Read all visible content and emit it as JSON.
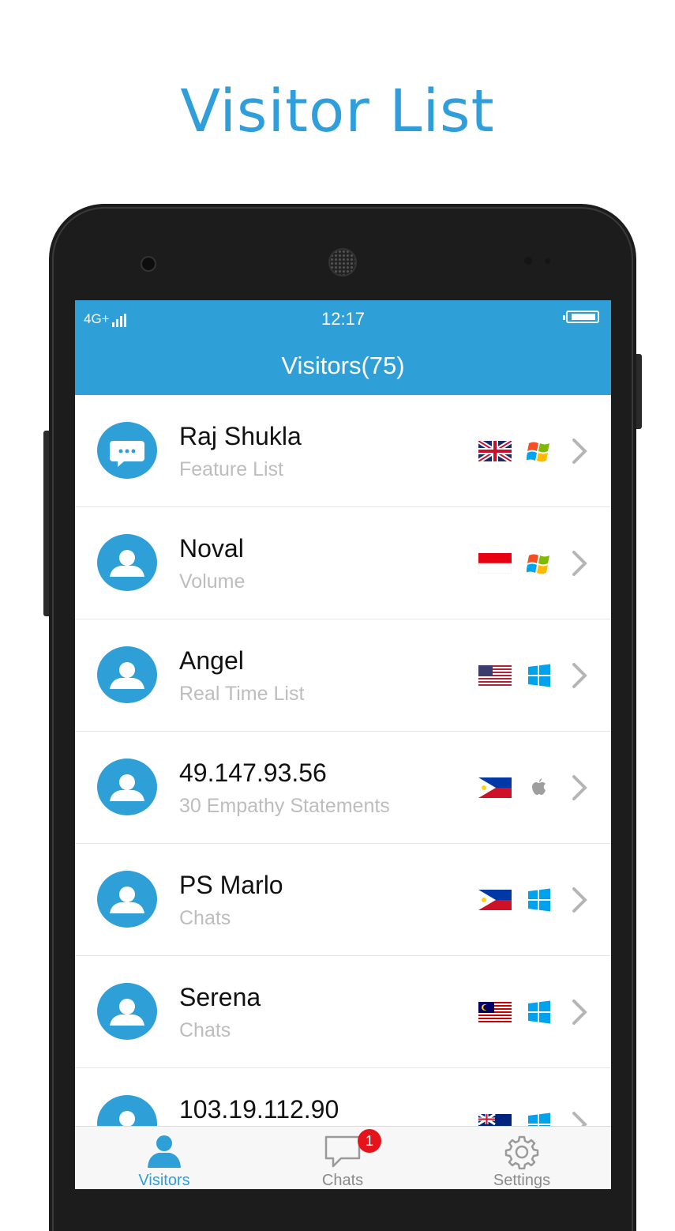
{
  "promo": {
    "title": "Visitor List"
  },
  "status_bar": {
    "network": "4G+",
    "time": "12:17"
  },
  "header": {
    "title": "Visitors(75)"
  },
  "visitors": [
    {
      "name": "Raj Shukla",
      "subtitle": "Feature List",
      "flag": "uk-flag",
      "os": "windows-xp-icon",
      "avatar": "chat-bubble-icon"
    },
    {
      "name": "Noval",
      "subtitle": "Volume",
      "flag": "indonesia-flag",
      "os": "windows-xp-icon",
      "avatar": "user-icon"
    },
    {
      "name": "Angel",
      "subtitle": "Real Time List",
      "flag": "usa-flag",
      "os": "windows-icon",
      "avatar": "user-icon"
    },
    {
      "name": "49.147.93.56",
      "subtitle": "30 Empathy Statements",
      "flag": "philippines-flag",
      "os": "apple-icon",
      "avatar": "user-icon"
    },
    {
      "name": "PS Marlo",
      "subtitle": "Chats",
      "flag": "philippines-flag",
      "os": "windows-icon",
      "avatar": "user-icon"
    },
    {
      "name": "Serena",
      "subtitle": "Chats",
      "flag": "malaysia-flag",
      "os": "windows-icon",
      "avatar": "user-icon"
    },
    {
      "name": "103.19.112.90",
      "subtitle": "",
      "flag": "new-zealand-flag",
      "os": "windows-icon",
      "avatar": "user-icon"
    }
  ],
  "tabs": [
    {
      "label": "Visitors",
      "active": true,
      "icon": "person-icon"
    },
    {
      "label": "Chats",
      "active": false,
      "icon": "chat-bubble-icon",
      "badge": "1"
    },
    {
      "label": "Settings",
      "active": false,
      "icon": "gear-icon"
    }
  ],
  "colors": {
    "accent": "#2f9fd8",
    "badge": "#e5141b"
  }
}
